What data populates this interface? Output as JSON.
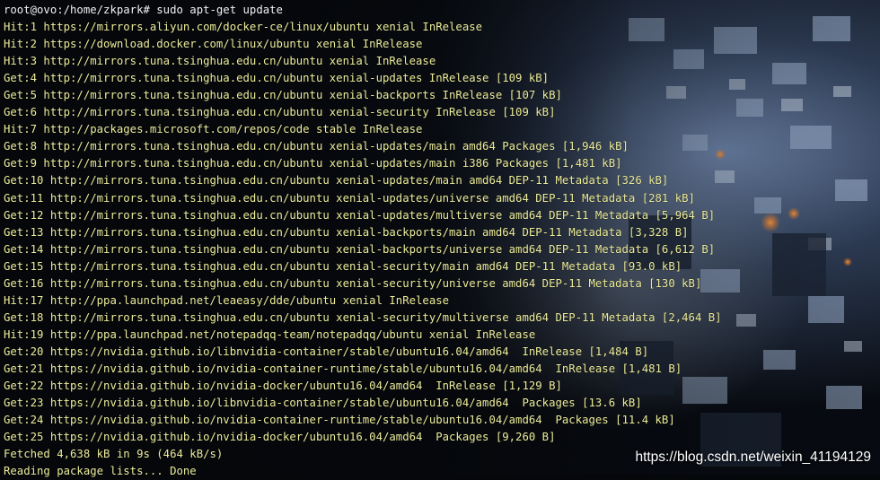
{
  "terminal": {
    "lines": [
      "root@ovo:/home/zkpark# sudo apt-get update",
      "Hit:1 https://mirrors.aliyun.com/docker-ce/linux/ubuntu xenial InRelease",
      "Hit:2 https://download.docker.com/linux/ubuntu xenial InRelease",
      "Hit:3 http://mirrors.tuna.tsinghua.edu.cn/ubuntu xenial InRelease",
      "Get:4 http://mirrors.tuna.tsinghua.edu.cn/ubuntu xenial-updates InRelease [109 kB]",
      "Get:5 http://mirrors.tuna.tsinghua.edu.cn/ubuntu xenial-backports InRelease [107 kB]",
      "Get:6 http://mirrors.tuna.tsinghua.edu.cn/ubuntu xenial-security InRelease [109 kB]",
      "Hit:7 http://packages.microsoft.com/repos/code stable InRelease",
      "Get:8 http://mirrors.tuna.tsinghua.edu.cn/ubuntu xenial-updates/main amd64 Packages [1,946 kB]",
      "Get:9 http://mirrors.tuna.tsinghua.edu.cn/ubuntu xenial-updates/main i386 Packages [1,481 kB]",
      "Get:10 http://mirrors.tuna.tsinghua.edu.cn/ubuntu xenial-updates/main amd64 DEP-11 Metadata [326 kB]",
      "Get:11 http://mirrors.tuna.tsinghua.edu.cn/ubuntu xenial-updates/universe amd64 DEP-11 Metadata [281 kB]",
      "Get:12 http://mirrors.tuna.tsinghua.edu.cn/ubuntu xenial-updates/multiverse amd64 DEP-11 Metadata [5,964 B]",
      "Get:13 http://mirrors.tuna.tsinghua.edu.cn/ubuntu xenial-backports/main amd64 DEP-11 Metadata [3,328 B]",
      "Get:14 http://mirrors.tuna.tsinghua.edu.cn/ubuntu xenial-backports/universe amd64 DEP-11 Metadata [6,612 B]",
      "Get:15 http://mirrors.tuna.tsinghua.edu.cn/ubuntu xenial-security/main amd64 DEP-11 Metadata [93.0 kB]",
      "Get:16 http://mirrors.tuna.tsinghua.edu.cn/ubuntu xenial-security/universe amd64 DEP-11 Metadata [130 kB]",
      "Hit:17 http://ppa.launchpad.net/leaeasy/dde/ubuntu xenial InRelease",
      "Get:18 http://mirrors.tuna.tsinghua.edu.cn/ubuntu xenial-security/multiverse amd64 DEP-11 Metadata [2,464 B]",
      "Hit:19 http://ppa.launchpad.net/notepadqq-team/notepadqq/ubuntu xenial InRelease",
      "Get:20 https://nvidia.github.io/libnvidia-container/stable/ubuntu16.04/amd64  InRelease [1,484 B]",
      "Get:21 https://nvidia.github.io/nvidia-container-runtime/stable/ubuntu16.04/amd64  InRelease [1,481 B]",
      "Get:22 https://nvidia.github.io/nvidia-docker/ubuntu16.04/amd64  InRelease [1,129 B]",
      "Get:23 https://nvidia.github.io/libnvidia-container/stable/ubuntu16.04/amd64  Packages [13.6 kB]",
      "Get:24 https://nvidia.github.io/nvidia-container-runtime/stable/ubuntu16.04/amd64  Packages [11.4 kB]",
      "Get:25 https://nvidia.github.io/nvidia-docker/ubuntu16.04/amd64  Packages [9,260 B]",
      "Fetched 4,638 kB in 9s (464 kB/s)",
      "Reading package lists... Done"
    ]
  },
  "watermark": {
    "text": "https://blog.csdn.net/weixin_41194129"
  },
  "colors": {
    "prompt": "#f2f2f2",
    "output": "#ecec9a",
    "background": "#05070b"
  }
}
